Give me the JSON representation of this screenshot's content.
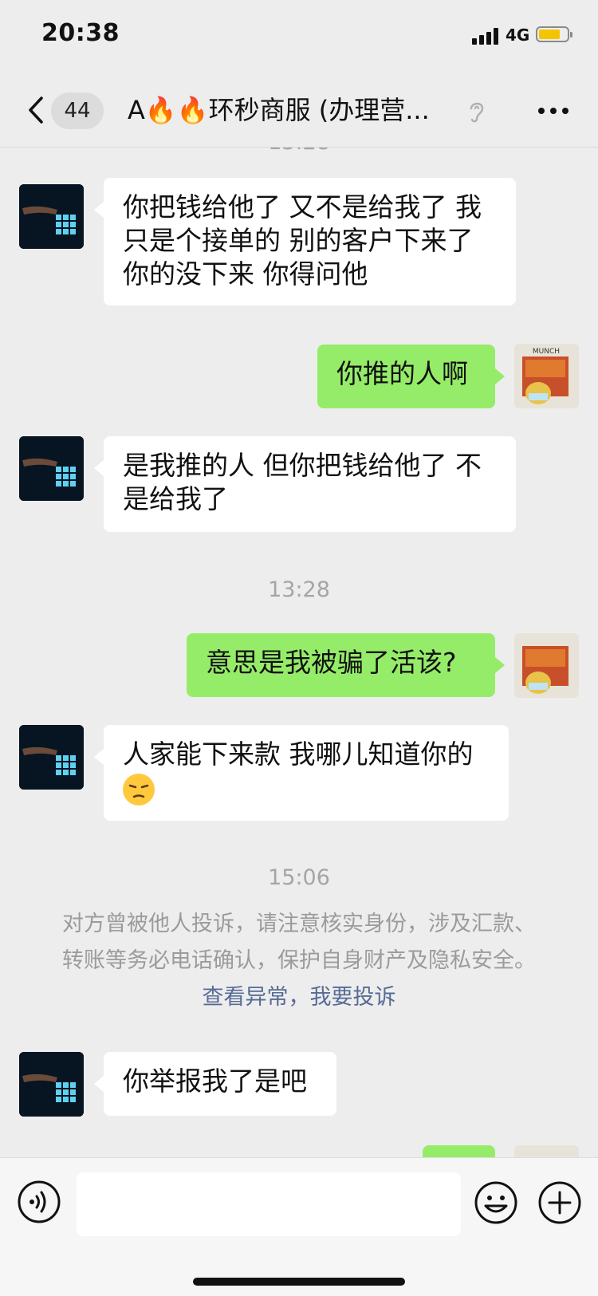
{
  "status": {
    "time": "20:38",
    "network": "4G"
  },
  "nav": {
    "unread_count": "44",
    "title": "A🔥🔥环秒商服 (办理营..."
  },
  "messages": [
    {
      "text": "你把钱给他了 又不是给我了 我只是个接单的 别的客户下来了你的没下来 你得问他"
    },
    {
      "text": "你推的人啊"
    },
    {
      "text": "是我推的人 但你把钱给他了 不是给我了"
    },
    {
      "text": "意思是我被骗了活该?"
    },
    {
      "text": "人家能下来款 我哪儿知道你的"
    },
    {
      "text": "你举报我了是吧"
    }
  ],
  "timestamps": {
    "t1": "13:28",
    "t2": "15:06"
  },
  "notice": {
    "line1": "对方曾被他人投诉，请注意核实身份，涉及汇款、",
    "line2": "转账等务必电话确认，保护自身财产及隐私安全。",
    "link1": "查看异常",
    "separator": "，",
    "link2": "我要投诉"
  },
  "avatars": {
    "right_caption": "MUNCH"
  },
  "colors": {
    "out_bubble": "#95ec69",
    "in_bubble": "#ffffff",
    "link": "#576b95",
    "background": "#ededed"
  },
  "icons": [
    "back-icon",
    "ear-icon",
    "more-icon",
    "voice-icon",
    "emoji-icon",
    "plus-icon",
    "unamused-face-emoji"
  ]
}
